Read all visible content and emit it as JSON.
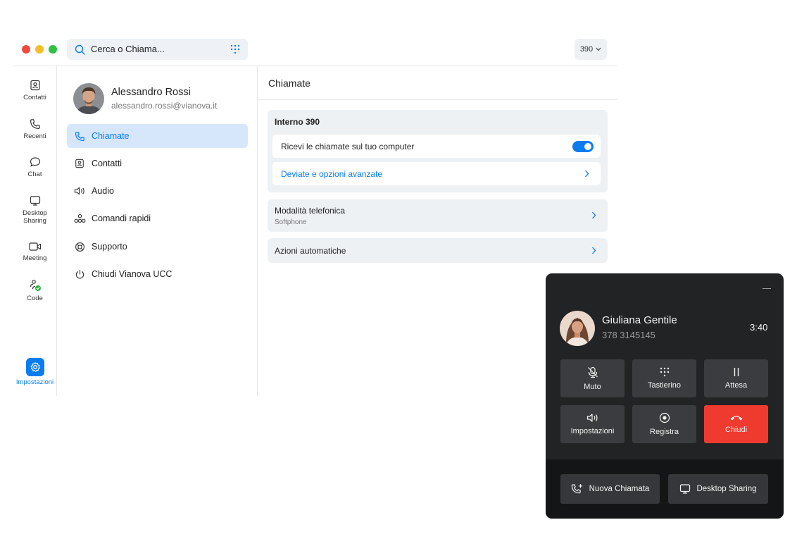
{
  "colors": {
    "accent": "#0b7cf0",
    "close_red": "#ef3b2f",
    "traffic": [
      "#ef4b3f",
      "#f5bd29",
      "#2fc141"
    ]
  },
  "search": {
    "placeholder": "Cerca o Chiama...",
    "keypad_icon": "dialpad-icon"
  },
  "extension_selector": {
    "value": "390"
  },
  "rail": {
    "items": [
      {
        "label": "Contatti",
        "icon": "contacts-icon"
      },
      {
        "label": "Recenti",
        "icon": "phone-icon"
      },
      {
        "label": "Chat",
        "icon": "chat-bubble-icon"
      },
      {
        "label": "Desktop Sharing",
        "icon": "monitor-icon"
      },
      {
        "label": "Meeting",
        "icon": "video-icon"
      },
      {
        "label": "Code",
        "icon": "queue-icon"
      }
    ],
    "settings": {
      "label": "Impostazioni",
      "icon": "gear-icon"
    }
  },
  "profile": {
    "name": "Alessandro Rossi",
    "email": "alessandro.rossi@vianova.it"
  },
  "menu": [
    {
      "label": "Chiamate",
      "icon": "phone-icon",
      "active": true
    },
    {
      "label": "Contatti",
      "icon": "contacts-icon"
    },
    {
      "label": "Audio",
      "icon": "speaker-icon"
    },
    {
      "label": "Comandi rapidi",
      "icon": "shortcuts-icon"
    },
    {
      "label": "Supporto",
      "icon": "lifebuoy-icon"
    },
    {
      "label": "Chiudi Vianova UCC",
      "icon": "power-icon"
    }
  ],
  "main": {
    "title": "Chiamate",
    "interno": {
      "header": "Interno 390",
      "receive_label": "Ricevi le chiamate sul tuo computer",
      "receive_enabled": true,
      "advanced_link": "Deviate e opzioni avanzate"
    },
    "modalita": {
      "title": "Modalità telefonica",
      "value": "Softphone"
    },
    "azioni": {
      "title": "Azioni automatiche"
    }
  },
  "call": {
    "caller_name": "Giuliana Gentile",
    "caller_number": "378 3145145",
    "duration": "3:40",
    "buttons": [
      {
        "label": "Muto",
        "icon": "mic-off-icon"
      },
      {
        "label": "Tastierino",
        "icon": "dialpad-icon"
      },
      {
        "label": "Attesa",
        "icon": "pause-icon"
      },
      {
        "label": "Impostazioni",
        "icon": "speaker-icon"
      },
      {
        "label": "Registra",
        "icon": "record-icon"
      },
      {
        "label": "Chiudi",
        "icon": "hangup-icon"
      }
    ],
    "footer": [
      {
        "label": "Nuova Chiamata",
        "icon": "add-call-icon"
      },
      {
        "label": "Desktop Sharing",
        "icon": "monitor-icon"
      }
    ]
  }
}
